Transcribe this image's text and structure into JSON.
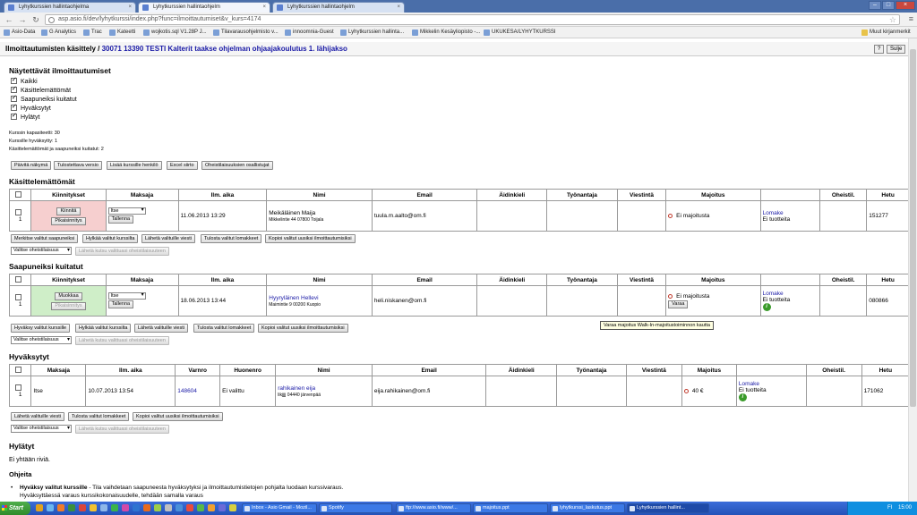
{
  "browser": {
    "tabs": [
      {
        "label": "Lyhytkurssien hallintaohjelma"
      },
      {
        "label": "Lyhytkurssien hallintaohjelm"
      },
      {
        "label": "Lyhytkurssien hallintaohjelm"
      }
    ],
    "url": "asp.asio.fi/dev/lyhytkurssi/index.php?func=ilmoittautumiset&v_kurs=4174",
    "bookmarks": [
      "Asio-Data",
      "G Analytics",
      "Trac",
      "Kateetti",
      "wojkotis.sql V1.28P J...",
      "Tilavarausohjelmisto v...",
      "innoomnia-Guest",
      "Lyhytkurssien hallinta...",
      "Mikkelin Kesäyliopisto -...",
      "UKUKESA/LYHYTKURSSI",
      "Muut kirjanmerkit"
    ]
  },
  "header": {
    "title": "Ilmoittautumisten käsittely",
    "separator": " / ",
    "course_link": "30071 13390 TESTI Kalterit taakse ohjelman ohjaajakoulutus 1. lähijakso",
    "help_label": "?",
    "close_label": "Sulje"
  },
  "filters": {
    "heading": "Näytettävät ilmoittautumiset",
    "items": [
      "Kaikki",
      "Käsittelemättömät",
      "Saapuneiksi kuitatut",
      "Hyväksytyt",
      "Hylätyt"
    ]
  },
  "stats": {
    "capacity": "Kurssin kapasiteetti: 30",
    "accepted": "Kurssille hyväksytty: 1",
    "pending": "Käsittelemättömät ja saapuneiksi kuitatut: 2"
  },
  "top_buttons": [
    "Päivitä näkymä",
    "Tulostettava versio",
    "Lisää kurssille henkilö",
    "Excel siirto",
    "Oheistilaisuuksien osallistujat"
  ],
  "pending": {
    "heading": "Käsittelemättömät",
    "columns": [
      "Kiinnitykset",
      "Maksaja",
      "Ilm. aika",
      "Nimi",
      "Email",
      "Äidinkieli",
      "Työnantaja",
      "Viestintä",
      "Majoitus",
      "",
      "Oheistil.",
      "Hetu"
    ],
    "row": {
      "index": "1",
      "btn1": "Kiinnitä",
      "btn2": "Pikaisinnitys",
      "payer": "Itse",
      "save": "Tallenna",
      "time": "11.06.2013 13:29",
      "name": "Meikäläinen Maija",
      "address": "Mikkelintie 44 07800 Toijala",
      "email": "tuula.m.aalto@om.fi",
      "lodging": "Ei majoitusta",
      "form_link": "Lomake",
      "products": "Ei tuotteita",
      "hetu": "151277"
    },
    "actions": [
      "Merkitse valitut saapuneiksi",
      "Hylkää valitut kurssilta",
      "Lähetä valituille viesti",
      "Tulosta valitut lomakkeet",
      "Kopioi valitut uusiksi ilmoittautumisiksi"
    ],
    "event_select": "Valitse oheistilaisuus",
    "invite": "Lähetä kutsu valittuasi oheistilaisuuteen"
  },
  "arrived": {
    "heading": "Saapuneiksi kuitatut",
    "columns": [
      "Kiinnitykset",
      "Maksaja",
      "Ilm. aika",
      "Nimi",
      "Email",
      "Äidinkieli",
      "Työnantaja",
      "Viestintä",
      "Majoitus",
      "",
      "Oheistil.",
      "Hetu"
    ],
    "row": {
      "index": "1",
      "btn1": "Muokkaa",
      "btn2": "Pikaisinnitys",
      "payer": "Itse",
      "save": "Tallenna",
      "time": "18.06.2013 13:44",
      "name": "Hyyryläinen Hellevi",
      "address": "Maimintie 9 00200 Kuopio",
      "email": "heli.niskanen@om.fi",
      "lodging": "Ei majoitusta",
      "book": "Varaa",
      "form_link": "Lomake",
      "products": "Ei tuotteita",
      "hetu": "080866"
    },
    "tooltip": "Varaa majoitus Walk-In-majoitustoiminnon kautta",
    "actions": [
      "Hyväksy valitut kurssille",
      "Hylkää valitut kurssilta",
      "Lähetä valituille viesti",
      "Tulosta valitut lomakkeet",
      "Kopioi valitut uusiksi ilmoittautumisiksi"
    ],
    "event_select": "Valitse oheistilaisuus",
    "invite": "Lähetä kutsu valittuasi oheistilaisuuteen"
  },
  "accepted": {
    "heading": "Hyväksytyt",
    "columns": [
      "Maksaja",
      "Ilm. aika",
      "Varnro",
      "Huonenro",
      "Nimi",
      "Email",
      "Äidinkieli",
      "Työnantaja",
      "Viestintä",
      "Majoitus",
      "",
      "Oheistil.",
      "Hetu"
    ],
    "row": {
      "index": "1",
      "payer": "Itse",
      "time": "10.07.2013 13:54",
      "varnro": "148604",
      "room": "Ei valittu",
      "name": "rahikainen eija",
      "address": "likjjjj 04440 järvenpää",
      "email": "eija.rahikainen@om.fi",
      "lodging": "40 €",
      "form_link": "Lomake",
      "products": "Ei tuotteita",
      "hetu": "171062"
    },
    "actions": [
      "Lähetä valituille viesti",
      "Tulosta valitut lomakkeet",
      "Kopioi valitut uusiksi ilmoittautumisiksi"
    ],
    "event_select": "Valitse oheistilaisuus",
    "invite": "Lähetä kutsu valittuasi oheistilaisuuteen"
  },
  "rejected": {
    "heading": "Hylätyt",
    "empty": "Ei yhtään riviä."
  },
  "help": {
    "heading": "Ohjeita",
    "bullet_title": "Hyväksy valitut kurssille",
    "bullet_text": " - Tila vaihdetaan saapuneesta hyväksytyksi ja ilmoittautumistietojen pohjalta luodaan kurssivaraus. Hyväksyttäessä varaus kurssikokonaisuudelle, tehdään samalla varaus"
  },
  "taskbar": {
    "start": "Start",
    "tasks": [
      "Inbox - Asio Gmail - Mozil...",
      "Spotify",
      "ftp://www.asio.fi/www/...",
      "majoitus.ppt",
      "lyhytkurssi_laskutus.ppt",
      "Lyhytkurssien hallint..."
    ],
    "lang": "FI",
    "clock": "15:00"
  }
}
